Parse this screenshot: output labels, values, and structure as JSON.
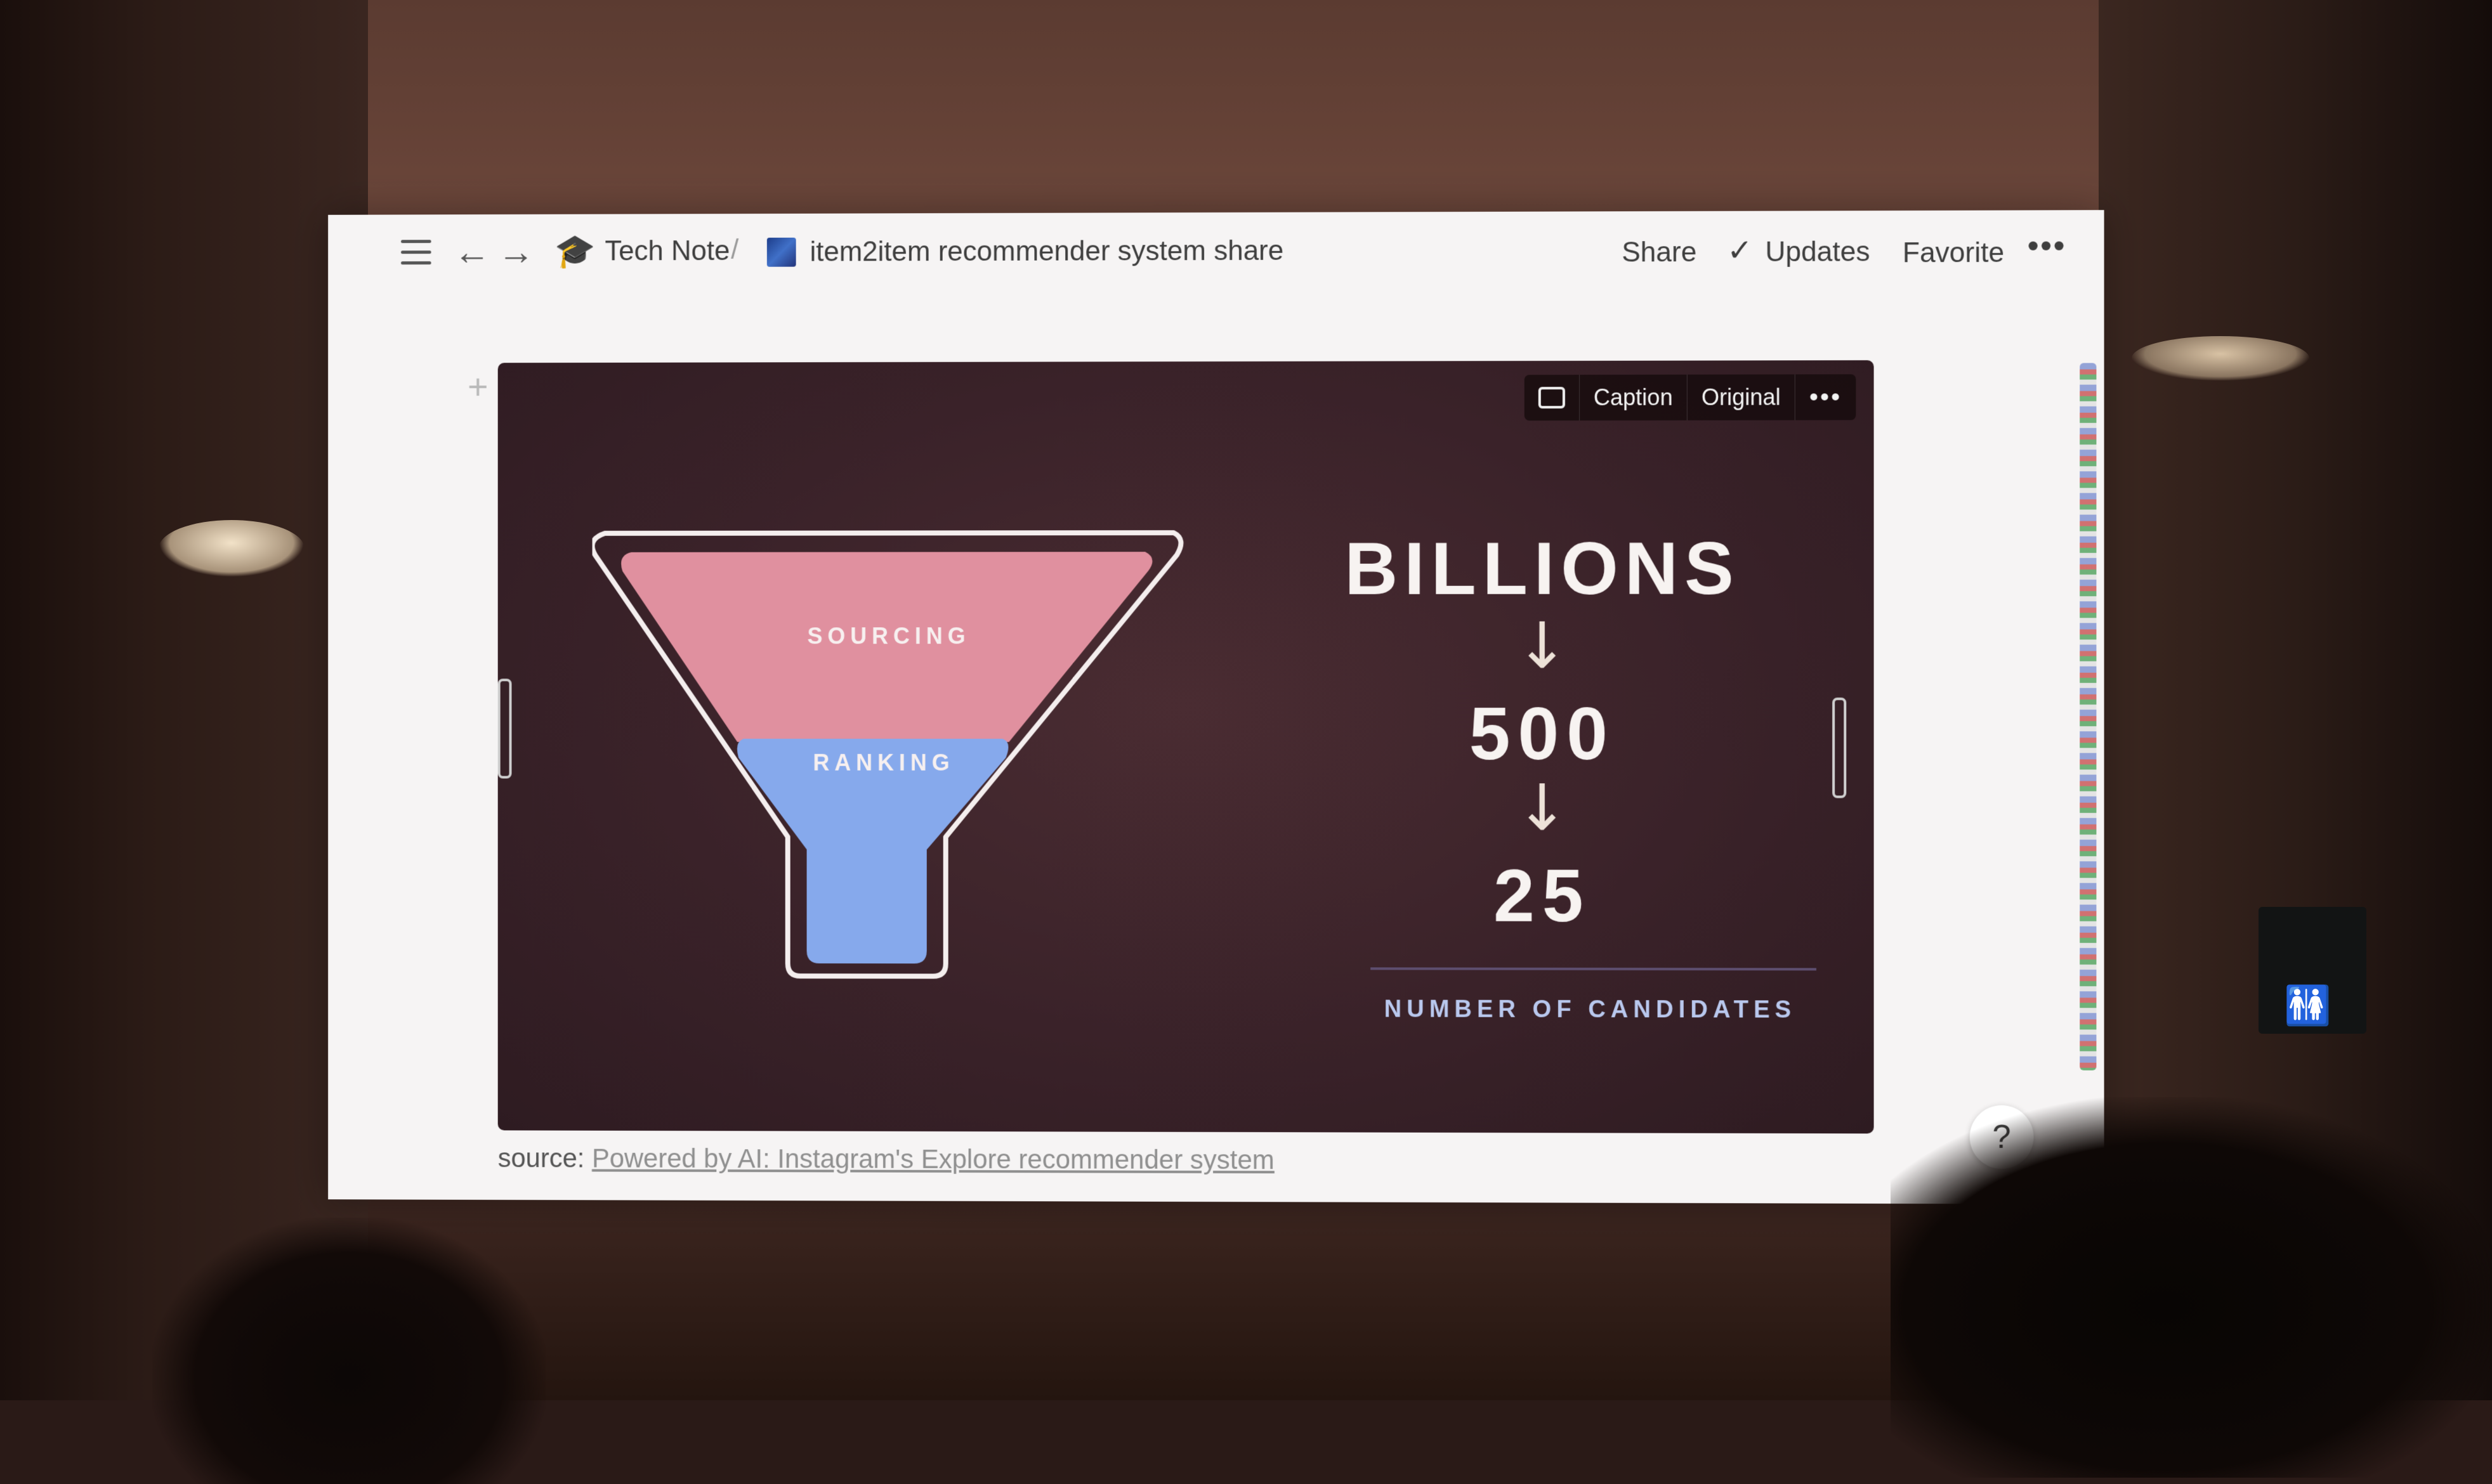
{
  "topbar": {
    "breadcrumb_1": "Tech Note",
    "breadcrumb_sep": "/",
    "breadcrumb_2": "item2item recommender system share",
    "share": "Share",
    "updates": "Updates",
    "favorite": "Favorite",
    "more": "•••"
  },
  "image_toolbar": {
    "caption": "Caption",
    "original": "Original",
    "more": "•••"
  },
  "slide": {
    "funnel_top": "SOURCING",
    "funnel_bottom": "RANKING",
    "value_1": "BILLIONS",
    "arrow": "↓",
    "value_2": "500",
    "value_3": "25",
    "axis_label": "NUMBER OF CANDIDATES",
    "colors": {
      "sourcing": "#e0909f",
      "ranking": "#86a9ec",
      "background": "#3a2229"
    }
  },
  "source": {
    "label": "source:",
    "link": "Powered by AI: Instagram's Explore recommender system"
  },
  "help": "?",
  "icons": [
    "menu-icon",
    "back-arrow-icon",
    "forward-arrow-icon",
    "graduation-cap-icon",
    "page-image-icon",
    "checkmark-icon",
    "more-icon",
    "comment-icon",
    "plus-icon",
    "drag-handle-icon",
    "help-icon"
  ]
}
